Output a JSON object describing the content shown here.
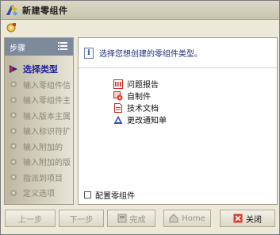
{
  "window": {
    "title": "新建零组件"
  },
  "steps": {
    "header": "步骤",
    "items": [
      {
        "label": "选择类型",
        "active": true
      },
      {
        "label": "输入零组件信",
        "active": false
      },
      {
        "label": "输入零组件主",
        "active": false
      },
      {
        "label": "输入版本主属",
        "active": false
      },
      {
        "label": "输入标识符扩",
        "active": false
      },
      {
        "label": "输入附加的",
        "active": false
      },
      {
        "label": "输入附加的版",
        "active": false
      },
      {
        "label": "指派到项目",
        "active": false
      },
      {
        "label": "定义选项",
        "active": false
      }
    ]
  },
  "main": {
    "prompt": "选择您想创建的零组件类型。",
    "types": [
      {
        "label": "问题报告",
        "icon": "problem-report-icon"
      },
      {
        "label": "自制件",
        "icon": "made-part-icon"
      },
      {
        "label": "技术文档",
        "icon": "tech-doc-icon"
      },
      {
        "label": "更改通知单",
        "icon": "change-notice-icon"
      }
    ],
    "config_label": "配置零组件"
  },
  "buttons": {
    "back": "上一步",
    "next": "下一步",
    "finish": "完成",
    "home": "Home",
    "close": "关闭"
  },
  "colors": {
    "steps_header_bg": "#7c8a9c",
    "active_step": "#2323a0",
    "prompt_text": "#1e2a7a"
  }
}
